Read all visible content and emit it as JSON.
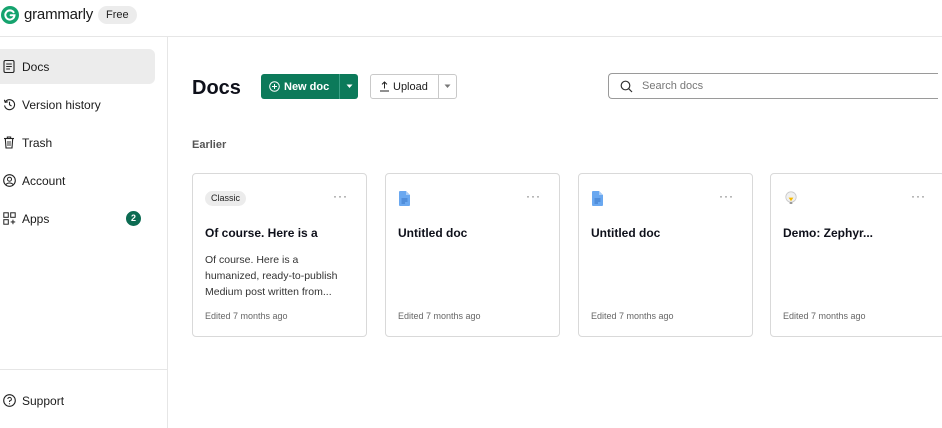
{
  "header": {
    "brand": "grammarly",
    "plan_badge": "Free",
    "logo_icon": "grammarly-logo-icon",
    "brand_color": "#15a36e"
  },
  "sidebar": {
    "items": [
      {
        "label": "Docs",
        "icon": "document-icon",
        "active": true
      },
      {
        "label": "Version history",
        "icon": "history-icon"
      },
      {
        "label": "Trash",
        "icon": "trash-icon"
      },
      {
        "label": "Account",
        "icon": "account-icon"
      },
      {
        "label": "Apps",
        "icon": "apps-icon",
        "count": "2"
      }
    ],
    "footer": {
      "label": "Support",
      "icon": "help-circle-icon"
    }
  },
  "main": {
    "title": "Docs",
    "new_doc_label": "New doc",
    "upload_label": "Upload",
    "search_placeholder": "Search docs",
    "section_label": "Earlier",
    "accent_color": "#0c7a5a"
  },
  "docs": [
    {
      "tag": "Classic",
      "title": "Of course. Here is a",
      "snippet": "Of course. Here is a humanized, ready-to-publish Medium post written from...",
      "edited": "Edited 7 months ago",
      "icon": ""
    },
    {
      "tag": "",
      "title": "Untitled doc",
      "snippet": "",
      "edited": "Edited 7 months ago",
      "icon": "document-file-icon"
    },
    {
      "tag": "",
      "title": "Untitled doc",
      "snippet": "",
      "edited": "Edited 7 months ago",
      "icon": "document-file-icon"
    },
    {
      "tag": "",
      "title": "Demo: Zephyr...",
      "snippet": "",
      "edited": "Edited 7 months ago",
      "icon": "lightbulb-icon"
    }
  ]
}
